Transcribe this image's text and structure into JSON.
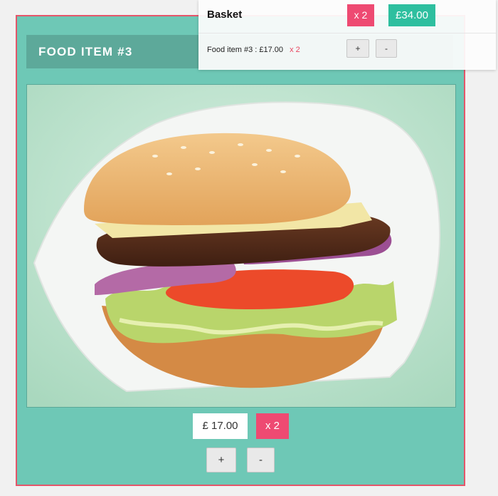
{
  "food_card": {
    "title": "FOOD ITEM #3",
    "price": "£ 17.00",
    "quantity": "x 2",
    "plus_label": "+",
    "minus_label": "-"
  },
  "basket": {
    "title": "Basket",
    "quantity": "x 2",
    "total": "£34.00",
    "items": [
      {
        "label": "Food item #3 : £17.00",
        "quantity": "x 2",
        "plus_label": "+",
        "minus_label": "-"
      }
    ]
  },
  "colors": {
    "card_background": "#6ec8b6",
    "card_border": "#e4566a",
    "title_bar": "#5da99a",
    "quantity_badge": "#ee4a72",
    "total_badge": "#2ebf9f"
  },
  "icons": {
    "food_image": "burger-photo"
  }
}
